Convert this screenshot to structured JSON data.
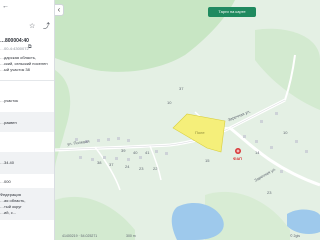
{
  "panel": {
    "cadastral_number": "…800004:40",
    "cadastral_number_sub": "…00-4:4300072",
    "address_lines": [
      "…дарская область,",
      "…ский, сельский поселен",
      "…ый участок 38"
    ],
    "category_fragment": "…участок",
    "type_fragment": "…раквен",
    "value_fragment": "…34.40",
    "value2_fragment": "…000",
    "owner_lines": [
      "Федерация",
      "…ая область,",
      "…тый округ",
      "…ий, с..."
    ],
    "icons": {
      "star": "star-icon",
      "share": "share-icon",
      "copy": "copy-icon"
    }
  },
  "map": {
    "switch_button": "Тарги на карте",
    "street_labels": [
      "ул. Полевая",
      "Заречная ул.",
      "Заречная ул."
    ],
    "parcel_label": "Поле",
    "fap_label": "ФАП",
    "number_labels": [
      "39",
      "40",
      "41",
      "38",
      "37",
      "24",
      "23",
      "22",
      "10",
      "37",
      "15",
      "14",
      "10",
      "23"
    ],
    "coords_text": "41400219 · 54.025271",
    "scale_text": "300 m",
    "copyright_text": "© 2gis",
    "colors": {
      "forest": "#c8e6c4",
      "meadow": "#e4f0e4",
      "parcel": "#f5ef7a",
      "water": "#9ec9ec",
      "road": "#ffffff",
      "fap": "#d93a3a"
    }
  }
}
